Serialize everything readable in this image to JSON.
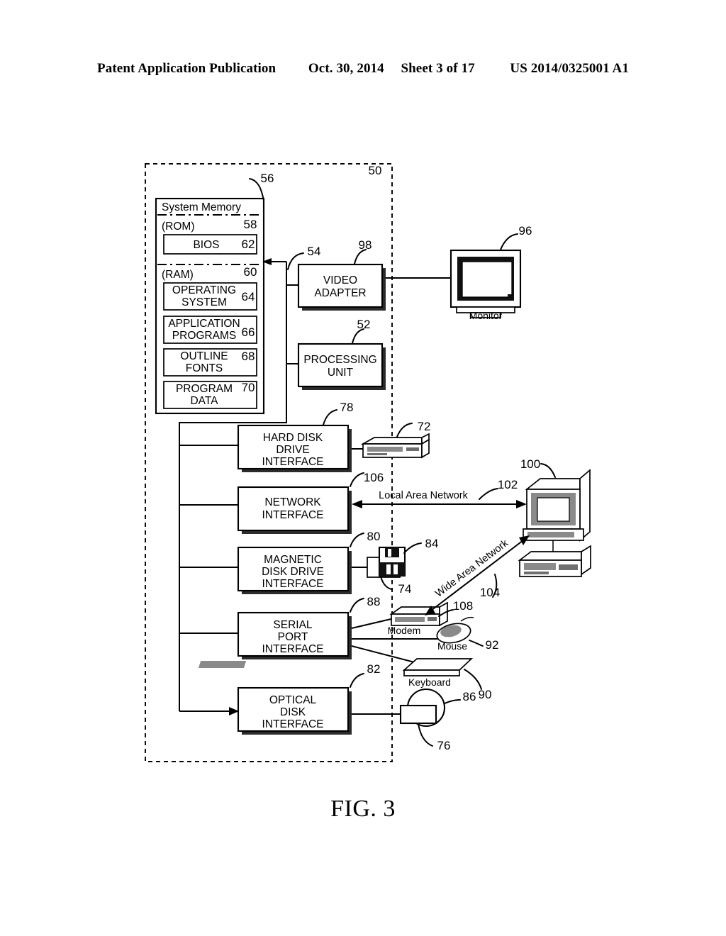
{
  "header": {
    "publication": "Patent Application Publication",
    "date": "Oct. 30, 2014",
    "sheet": "Sheet 3 of 17",
    "number": "US 2014/0325001 A1"
  },
  "figure": {
    "caption": "FIG. 3",
    "system_ref": "50"
  },
  "system_memory": {
    "title": "System Memory",
    "ref": "56",
    "rom": {
      "label": "(ROM)",
      "ref": "58"
    },
    "bios": {
      "label": "BIOS",
      "ref": "62"
    },
    "ram": {
      "label": "(RAM)",
      "ref": "60"
    },
    "blocks": [
      {
        "line1": "OPERATING",
        "line2": "SYSTEM",
        "ref": "64"
      },
      {
        "line1": "APPLICATION",
        "line2": "PROGRAMS",
        "ref": "66"
      },
      {
        "line1": "OUTLINE",
        "line2": "FONTS",
        "ref": "68"
      },
      {
        "line1": "PROGRAM",
        "line2": "DATA",
        "ref": "70"
      }
    ]
  },
  "bus": {
    "ref": "54"
  },
  "video_adapter": {
    "line1": "VIDEO",
    "line2": "ADAPTER",
    "ref": "98"
  },
  "processing_unit": {
    "line1": "PROCESSING",
    "line2": "UNIT",
    "ref": "52"
  },
  "monitor": {
    "label": "Monitor",
    "ref": "96"
  },
  "interfaces": [
    {
      "line1": "HARD DISK",
      "line2": "DRIVE",
      "line3": "INTERFACE",
      "ref": "78"
    },
    {
      "line1": "NETWORK",
      "line2": "INTERFACE",
      "line3": "",
      "ref": "106"
    },
    {
      "line1": "MAGNETIC",
      "line2": "DISK DRIVE",
      "line3": "INTERFACE",
      "ref": "80"
    },
    {
      "line1": "SERIAL",
      "line2": "PORT",
      "line3": "INTERFACE",
      "ref": "88"
    },
    {
      "line1": "OPTICAL",
      "line2": "DISK",
      "line3": "INTERFACE",
      "ref": "82"
    }
  ],
  "peripherals": {
    "hard_disk_drive": {
      "ref": "72"
    },
    "floppy_disk": {
      "ref": "84"
    },
    "floppy_drive": {
      "ref": "74"
    },
    "modem": {
      "label": "Modem",
      "ref": "108"
    },
    "mouse": {
      "label": "Mouse",
      "ref": "92"
    },
    "keyboard": {
      "label": "Keyboard",
      "ref": "90"
    },
    "optical_disk": {
      "ref": "86"
    },
    "optical_drive": {
      "ref": "76"
    },
    "remote_computer": {
      "ref": "100"
    }
  },
  "networks": {
    "lan": {
      "label": "Local Area Network",
      "ref": "102"
    },
    "wan": {
      "label": "Wide Area Network",
      "ref": "104"
    }
  }
}
